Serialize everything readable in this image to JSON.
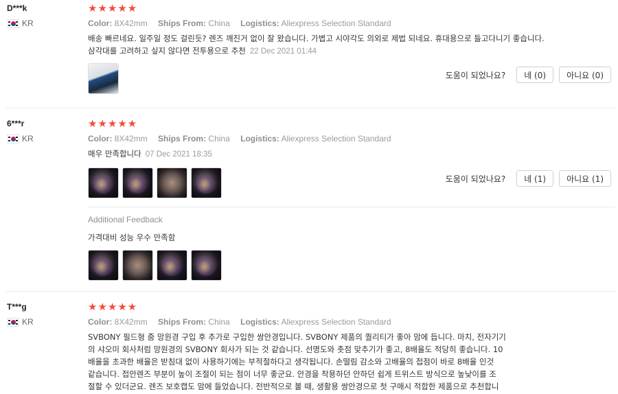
{
  "helpful_label": "도움이 되었나요?",
  "stars": "★★★★★",
  "meta_labels": {
    "color": "Color:",
    "ships": "Ships From:",
    "logistics": "Logistics:"
  },
  "reviews": [
    {
      "user": "D***k",
      "country": "KR",
      "color": "8X42mm",
      "ships_from": "China",
      "logistics": "Aliexpress Selection Standard",
      "text": "배송 빠르네요. 일주일 정도 걸린듯? 렌즈 깨진거 없이 잘 왔습니다. 가볍고 시야각도 의외로 제법 되네요. 휴대용으로 들고다니기 좋습니다. 삼각대를 고려하고 싶지 않다면 전투용으로 추천",
      "date": "22 Dec 2021 01:44",
      "yes": "네 (0)",
      "no": "아니요 (0)"
    },
    {
      "user": "6***r",
      "country": "KR",
      "color": "8X42mm",
      "ships_from": "China",
      "logistics": "Aliexpress Selection Standard",
      "text": "매우 만족합니다",
      "date": "07 Dec 2021 18:35",
      "yes": "네 (1)",
      "no": "아니요 (1)",
      "additional_title": "Additional Feedback",
      "additional_text": "가격대비 성능 우수 만족함"
    },
    {
      "user": "T***g",
      "country": "KR",
      "color": "8X42mm",
      "ships_from": "China",
      "logistics": "Aliexpress Selection Standard",
      "text_lines": [
        "SVBONY 필드형 줌 망원경 구입 후 추가로 구입한 쌍안경입니다. SVBONY 제품의 퀄리티가 좋아 맘에 듭니다. 마치, 전자기기",
        "의 샤오미 회사처럼 망원경의 SVBONY 회사가 되는 것 같습니다. 선명도와 촛점 맞추기가 좋고, 8배율도 적당히 좋습니다. 10",
        "배율을 초과한 배율은 받침대 없이 사용하기에는 부적절하다고 생각됩니다. 손떨림 감소와 고배율의 접점이 바로 8배율 인것",
        "같습니다. 접안렌즈 부분이 높이 조절이 되는 점이 너무 좋군요. 안경을 착용하던 안하던 쉽게 트위스트 방식으로 높낮이를 조",
        "절할 수 있더군요. 렌즈 보호캡도 맘에 들었습니다. 전반적으로 볼 때, 생활용 쌍안경으로 첫 구매시 적합한 제품으로 추천합니"
      ]
    }
  ]
}
